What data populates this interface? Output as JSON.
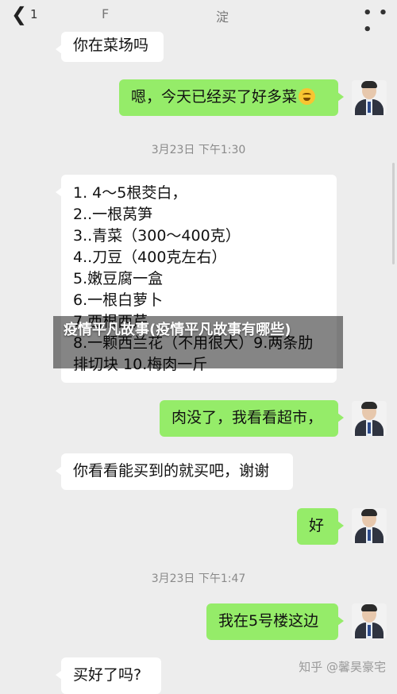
{
  "header": {
    "back_icon": "chevron-left-icon",
    "unread_badge": "1",
    "title_fragment_left": "F",
    "title_fragment_right": "淀",
    "more_icon": "more-dots-icon",
    "more_glyph": "• • •"
  },
  "messages": [
    {
      "side": "left",
      "text": "你在菜场吗"
    },
    {
      "side": "right",
      "text": "嗯，今天已经买了好多菜",
      "emoji": "laughing-tears-emoji-icon"
    },
    {
      "type": "timestamp",
      "text": "3月23日 下午1:30"
    },
    {
      "side": "left",
      "lines": [
        "1. 4～5根茭白，",
        "2..一根莴笋",
        "3..青菜（300～400克）",
        "4..刀豆（400克左右）",
        "5.嫩豆腐一盒",
        "6.一根白萝卜",
        "7.西根西芹",
        "8.一颗西兰花（不用很大）9.两条肋",
        "排切块 10.梅肉一斤"
      ]
    },
    {
      "side": "right",
      "text": "肉没了，我看看超市，"
    },
    {
      "side": "left",
      "text": "你看看能买到的就买吧，谢谢"
    },
    {
      "side": "right",
      "text": "好"
    },
    {
      "type": "timestamp",
      "text": "3月23日 下午1:47"
    },
    {
      "side": "right",
      "text": "我在5号楼这边"
    },
    {
      "side": "left",
      "text": "买好了吗?"
    }
  ],
  "overlay": {
    "text": "疫情平凡故事(疫情平凡故事有哪些)"
  },
  "watermark": {
    "text": "知乎 @馨昊豪宅"
  },
  "colors": {
    "background": "#ededed",
    "bubble_self": "#95ec69",
    "bubble_other": "#ffffff",
    "timestamp": "#8a8a8a"
  }
}
